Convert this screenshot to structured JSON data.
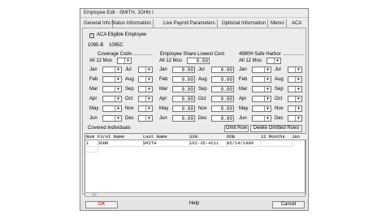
{
  "window": {
    "title": "Employee Edit - SMITH, JOHN I."
  },
  "tabs": [
    "General Info",
    "Status Information",
    "Live Payroll Parameters",
    "Optional Information",
    "Memo",
    "ACA"
  ],
  "aca": {
    "eligible_label": "ACA Eligible Employee",
    "eligible_checked": "✓",
    "form_tabs": [
      "1095-B",
      "1095C"
    ],
    "groups": {
      "coverage_code": "Coverage Code",
      "employee_share": "Employee Share Lowest Cost",
      "safe_harbor": "4980H Safe Harbor"
    },
    "all12": "All 12 Mos",
    "share_all": "0.00",
    "months_left": [
      "Jan",
      "Feb",
      "Mar",
      "Apr",
      "May",
      "Jun"
    ],
    "months_right": [
      "Jul",
      "Aug",
      "Sep",
      "Oct",
      "Nov",
      "Dec"
    ],
    "share_values_left": [
      "0.00",
      "0.00",
      "0.00",
      "0.00",
      "0.00",
      "0.00"
    ],
    "share_values_right": [
      "0.00",
      "0.00",
      "0.00",
      "0.00",
      "0.00",
      "0.00"
    ]
  },
  "covered": {
    "label": "Covered Individuals",
    "omit_row": "Omit Row",
    "delete_omitted": "Delete Omitted Rows",
    "columns": [
      "Num",
      "First Name",
      "Last Name",
      "SSN",
      "DOB",
      "12 Months",
      "Jan"
    ],
    "rows": [
      {
        "num": "1",
        "first": "JOHN",
        "last": "SMITH",
        "ssn": "162-35-4211",
        "dob": "05/14/1990"
      }
    ]
  },
  "footer": {
    "ok": "OK",
    "help": "Help",
    "cancel": "Cancel"
  }
}
